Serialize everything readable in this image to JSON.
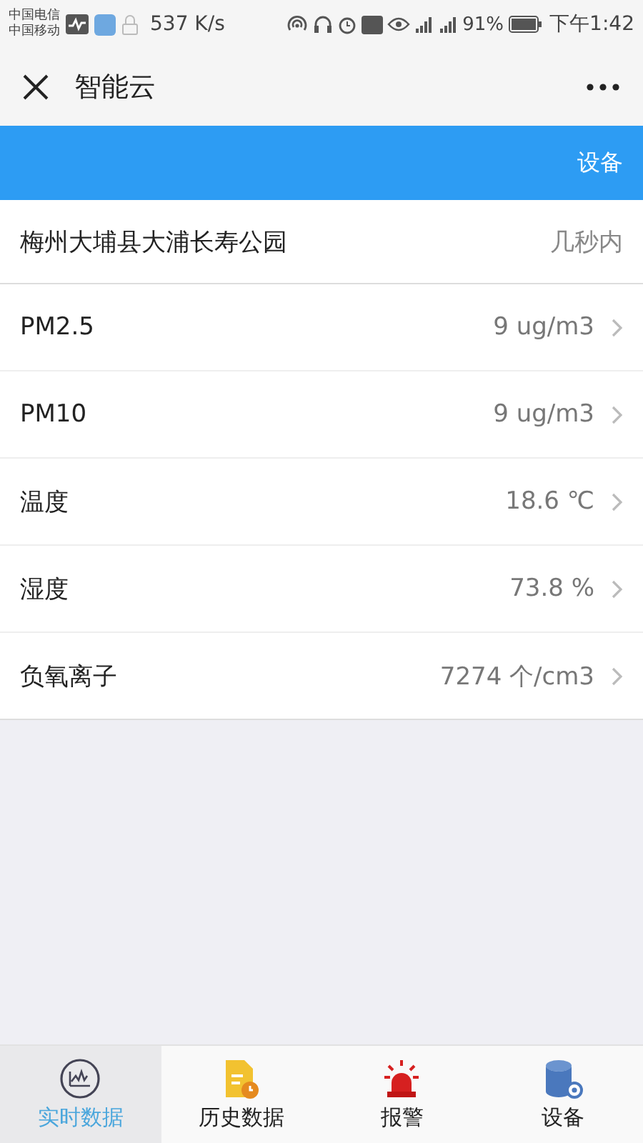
{
  "status_bar": {
    "carriers": [
      "中国电信",
      "中国移动"
    ],
    "speed": "537 K/s",
    "battery": "91%",
    "time": "下午1:42"
  },
  "header": {
    "title": "智能云"
  },
  "banner": {
    "label": "设备"
  },
  "location": {
    "name": "梅州大埔县大浦长寿公园",
    "updated": "几秒内"
  },
  "readings": [
    {
      "name": "PM2.5",
      "value": "9 ug/m3"
    },
    {
      "name": "PM10",
      "value": "9 ug/m3"
    },
    {
      "name": "温度",
      "value": "18.6 ℃"
    },
    {
      "name": "湿度",
      "value": "73.8 %"
    },
    {
      "name": "负氧离子",
      "value": "7274 个/cm3"
    }
  ],
  "tabs": [
    {
      "label": "实时数据",
      "kind": "chart",
      "selected": true
    },
    {
      "label": "历史数据",
      "kind": "history",
      "selected": false
    },
    {
      "label": "报警",
      "kind": "alarm",
      "selected": false
    },
    {
      "label": "设备",
      "kind": "device",
      "selected": false
    }
  ]
}
